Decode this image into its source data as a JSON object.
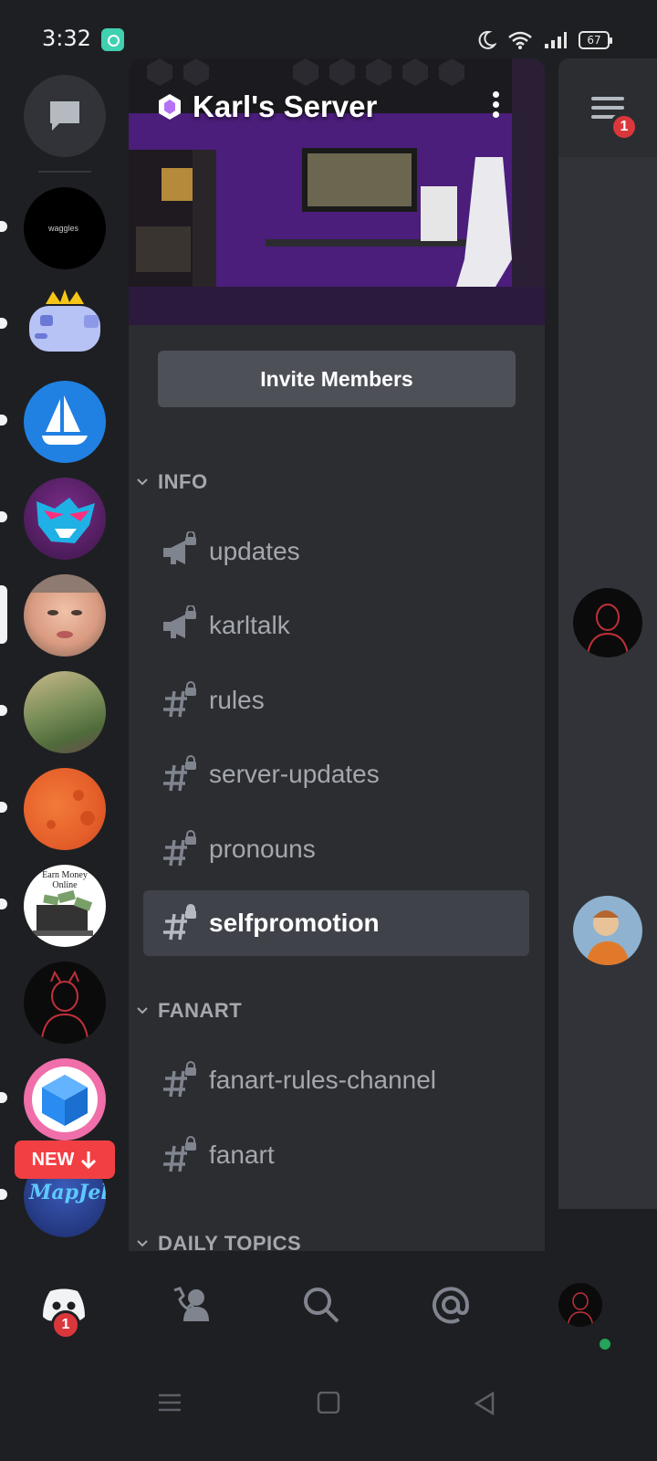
{
  "status_bar": {
    "time": "3:32",
    "battery": "67",
    "icons": [
      "moon-icon",
      "wifi-icon",
      "signal-icon",
      "battery-icon"
    ]
  },
  "server": {
    "name": "Karl's Server",
    "invite_label": "Invite Members"
  },
  "categories": [
    {
      "label": "INFO"
    },
    {
      "label": "FANART"
    },
    {
      "label": "DAILY TOPICS"
    }
  ],
  "channels": [
    {
      "name": "updates",
      "icon": "announcement-locked-icon"
    },
    {
      "name": "karltalk",
      "icon": "announcement-locked-icon"
    },
    {
      "name": "rules",
      "icon": "hash-locked-icon"
    },
    {
      "name": "server-updates",
      "icon": "hash-locked-icon"
    },
    {
      "name": "pronouns",
      "icon": "hash-locked-icon"
    },
    {
      "name": "selfpromotion",
      "icon": "hash-locked-icon",
      "selected": true
    },
    {
      "name": "fanart-rules-channel",
      "icon": "hash-locked-icon"
    },
    {
      "name": "fanart",
      "icon": "hash-locked-icon"
    }
  ],
  "server_rail": {
    "new_label": "NEW",
    "servers": [
      {
        "name": "waggles-server-icon",
        "text": "waggles"
      },
      {
        "name": "crowned-bot-server-icon"
      },
      {
        "name": "sailboat-server-icon"
      },
      {
        "name": "mrbeast-server-icon"
      },
      {
        "name": "karl-server-icon"
      },
      {
        "name": "garden-server-icon"
      },
      {
        "name": "planet-server-icon"
      },
      {
        "name": "earn-money-server-icon",
        "text": "Earn Money Online"
      },
      {
        "name": "sketch-avatar-server-icon"
      },
      {
        "name": "cube-server-icon"
      },
      {
        "name": "mapjelly-server-icon",
        "text": "MapJelly"
      }
    ]
  },
  "preview": {
    "notification_count": "1"
  },
  "bottom_nav": {
    "home_badge": "1",
    "items": [
      "home-icon",
      "friends-icon",
      "search-icon",
      "mentions-icon",
      "profile-avatar"
    ]
  },
  "colors": {
    "background": "#1e1f22",
    "panel": "#2b2d31",
    "selected": "#404249",
    "danger": "#f23f43",
    "online": "#23a55a"
  }
}
